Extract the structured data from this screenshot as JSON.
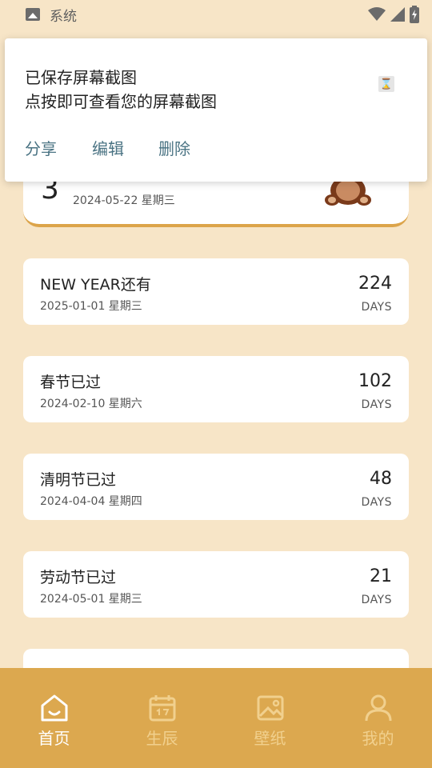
{
  "status_bar": {
    "app_label": "系统"
  },
  "notification": {
    "line1": "已保存屏幕截图",
    "line2": "点按即可查看您的屏幕截图",
    "actions": [
      "分享",
      "编辑",
      "删除"
    ]
  },
  "featured": {
    "number": "3",
    "date": "2024-05-22 星期三"
  },
  "events": [
    {
      "title": "NEW YEAR还有",
      "date": "2025-01-01 星期三",
      "days": "224",
      "unit": "DAYS"
    },
    {
      "title": "春节已过",
      "date": "2024-02-10 星期六",
      "days": "102",
      "unit": "DAYS"
    },
    {
      "title": "清明节已过",
      "date": "2024-04-04 星期四",
      "days": "48",
      "unit": "DAYS"
    },
    {
      "title": "劳动节已过",
      "date": "2024-05-01 星期三",
      "days": "21",
      "unit": "DAYS"
    }
  ],
  "bottom_nav": [
    {
      "label": "首页",
      "icon": "home-icon",
      "active": true
    },
    {
      "label": "生辰",
      "icon": "calendar-icon",
      "active": false
    },
    {
      "label": "壁纸",
      "icon": "image-icon",
      "active": false
    },
    {
      "label": "我的",
      "icon": "user-icon",
      "active": false
    }
  ],
  "colors": {
    "background": "#f7e5c7",
    "accent": "#dca84f",
    "action_text": "#4a7383"
  }
}
